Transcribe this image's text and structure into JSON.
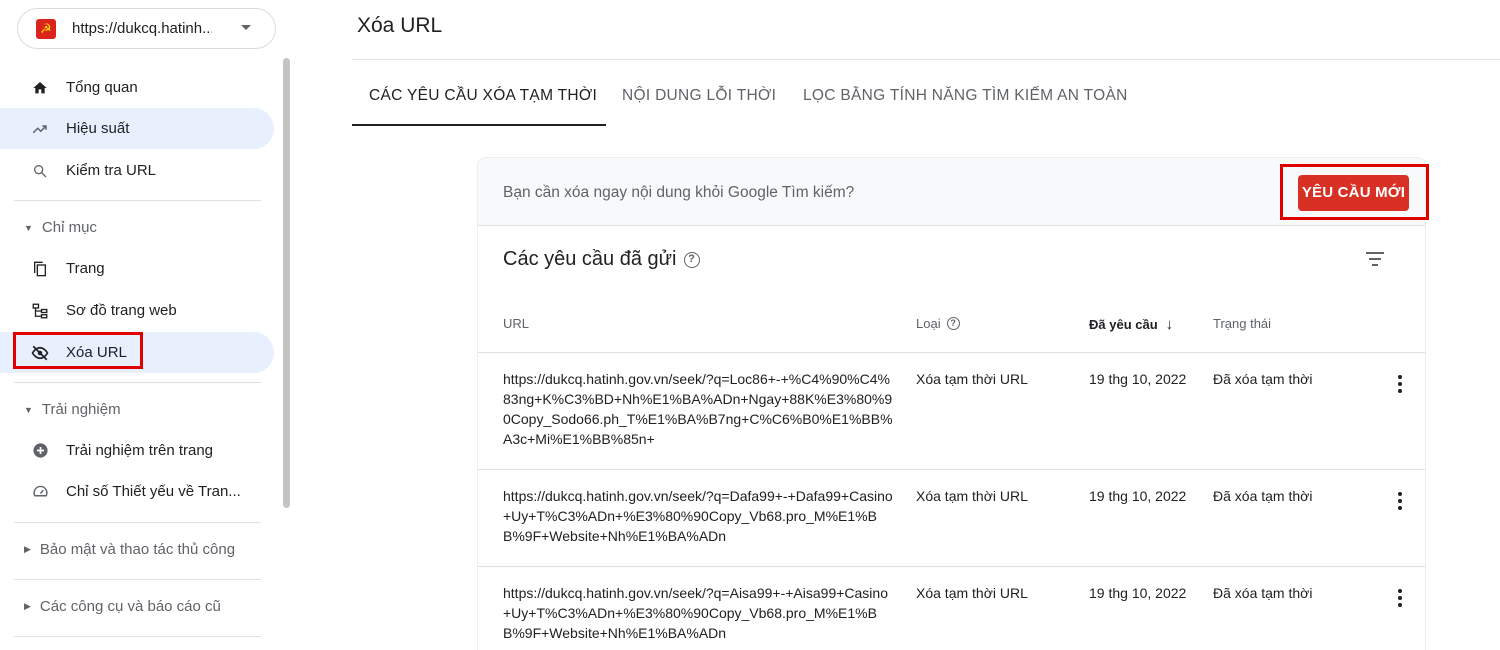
{
  "property": {
    "label": "https://dukcq.hatinh...",
    "logo_glyph": "☭",
    "logo_color": "#da251d"
  },
  "sidebar": {
    "top_items": [
      {
        "label": "Tổng quan",
        "icon": "home-icon"
      },
      {
        "label": "Hiệu suất",
        "icon": "trending-icon"
      },
      {
        "label": "Kiểm tra URL",
        "icon": "search-icon"
      }
    ],
    "index_section": {
      "title": "Chỉ mục",
      "items": [
        {
          "label": "Trang",
          "icon": "pages-icon"
        },
        {
          "label": "Sơ đồ trang web",
          "icon": "sitemap-icon"
        },
        {
          "label": "Xóa URL",
          "icon": "eye-off-icon"
        }
      ]
    },
    "experience_section": {
      "title": "Trải nghiệm",
      "items": [
        {
          "label": "Trải nghiệm trên trang",
          "icon": "plus-circle-icon"
        },
        {
          "label": "Chỉ số Thiết yếu về Tran...",
          "icon": "gauge-icon"
        }
      ]
    },
    "security_section": {
      "title": "Bảo mật và thao tác thủ công"
    },
    "legacy_section": {
      "title": "Các công cụ và báo cáo cũ"
    }
  },
  "page": {
    "title": "Xóa URL"
  },
  "tabs": [
    {
      "label": "CÁC YÊU CẦU XÓA TẠM THỜI"
    },
    {
      "label": "NỘI DUNG LỖI THỜI"
    },
    {
      "label": "LỌC BẰNG TÍNH NĂNG TÌM KIẾM AN TOÀN"
    }
  ],
  "card": {
    "question": "Bạn cần xóa ngay nội dung khỏi Google Tìm kiếm?",
    "new_request_label": "YÊU CẦU MỚI",
    "subtitle": "Các yêu cầu đã gửi",
    "help_glyph": "?",
    "columns": {
      "url": "URL",
      "type": "Loại",
      "requested": "Đã yêu cầu",
      "sort_glyph": "↓",
      "status": "Trạng thái"
    },
    "rows": [
      {
        "url": "https://dukcq.hatinh.gov.vn/seek/?q=Loc86+-+%C4%90%C4%83ng+K%C3%BD+Nh%E1%BA%ADn+Ngay+88K%E3%80%90Copy_Sodo66.ph_T%E1%BA%B7ng+C%C6%B0%E1%BB%A3c+Mi%E1%BB%85n+",
        "type": "Xóa tạm thời URL",
        "requested": "19 thg 10, 2022",
        "status": "Đã xóa tạm thời"
      },
      {
        "url": "https://dukcq.hatinh.gov.vn/seek/?q=Dafa99+-+Dafa99+Casino+Uy+T%C3%ADn+%E3%80%90Copy_Vb68.pro_M%E1%BB%9F+Website+Nh%E1%BA%ADn",
        "type": "Xóa tạm thời URL",
        "requested": "19 thg 10, 2022",
        "status": "Đã xóa tạm thời"
      },
      {
        "url": "https://dukcq.hatinh.gov.vn/seek/?q=Aisa99+-+Aisa99+Casino+Uy+T%C3%ADn+%E3%80%90Copy_Vb68.pro_M%E1%BB%9F+Website+Nh%E1%BA%ADn",
        "type": "Xóa tạm thời URL",
        "requested": "19 thg 10, 2022",
        "status": "Đã xóa tạm thời"
      }
    ]
  },
  "colors": {
    "accent_red": "#d93025",
    "active_bg": "#e8f0fe",
    "highlight": "#e00000"
  }
}
